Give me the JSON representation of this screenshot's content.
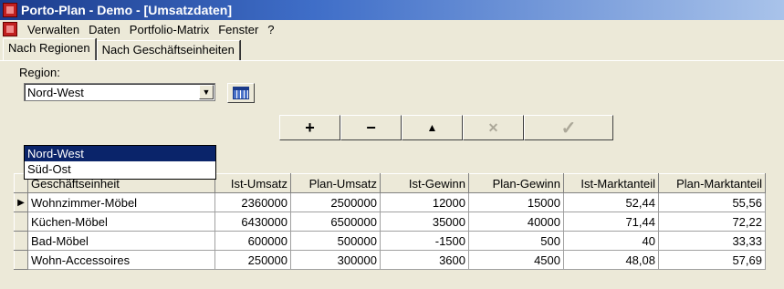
{
  "window": {
    "title": "Porto-Plan - Demo - [Umsatzdaten]"
  },
  "menu": {
    "items": [
      "Verwalten",
      "Daten",
      "Portfolio-Matrix",
      "Fenster",
      "?"
    ]
  },
  "tabs": [
    {
      "label": "Nach Regionen"
    },
    {
      "label": "Nach Geschäftseinheiten"
    }
  ],
  "region": {
    "label": "Region:",
    "selected": "Nord-West",
    "options": [
      "Nord-West",
      "Süd-Ost"
    ]
  },
  "toolbar": {
    "add": "+",
    "remove": "−",
    "up": "▲",
    "cancel": "✕",
    "confirm": "✓"
  },
  "table": {
    "headers": [
      "Geschäftseinheit",
      "Ist-Umsatz",
      "Plan-Umsatz",
      "Ist-Gewinn",
      "Plan-Gewinn",
      "Ist-Marktanteil",
      "Plan-Marktanteil"
    ],
    "rows": [
      [
        "Wohnzimmer-Möbel",
        "2360000",
        "2500000",
        "12000",
        "15000",
        "52,44",
        "55,56"
      ],
      [
        "Küchen-Möbel",
        "6430000",
        "6500000",
        "35000",
        "40000",
        "71,44",
        "72,22"
      ],
      [
        "Bad-Möbel",
        "600000",
        "500000",
        "-1500",
        "500",
        "40",
        "33,33"
      ],
      [
        "Wohn-Accessoires",
        "250000",
        "300000",
        "3600",
        "4500",
        "48,08",
        "57,69"
      ]
    ],
    "current_row_marker": "▶"
  },
  "colors": {
    "title_start": "#1c3c8c",
    "title_end": "#a9c3ea",
    "selection": "#0a246a",
    "face": "#ece9d8"
  }
}
